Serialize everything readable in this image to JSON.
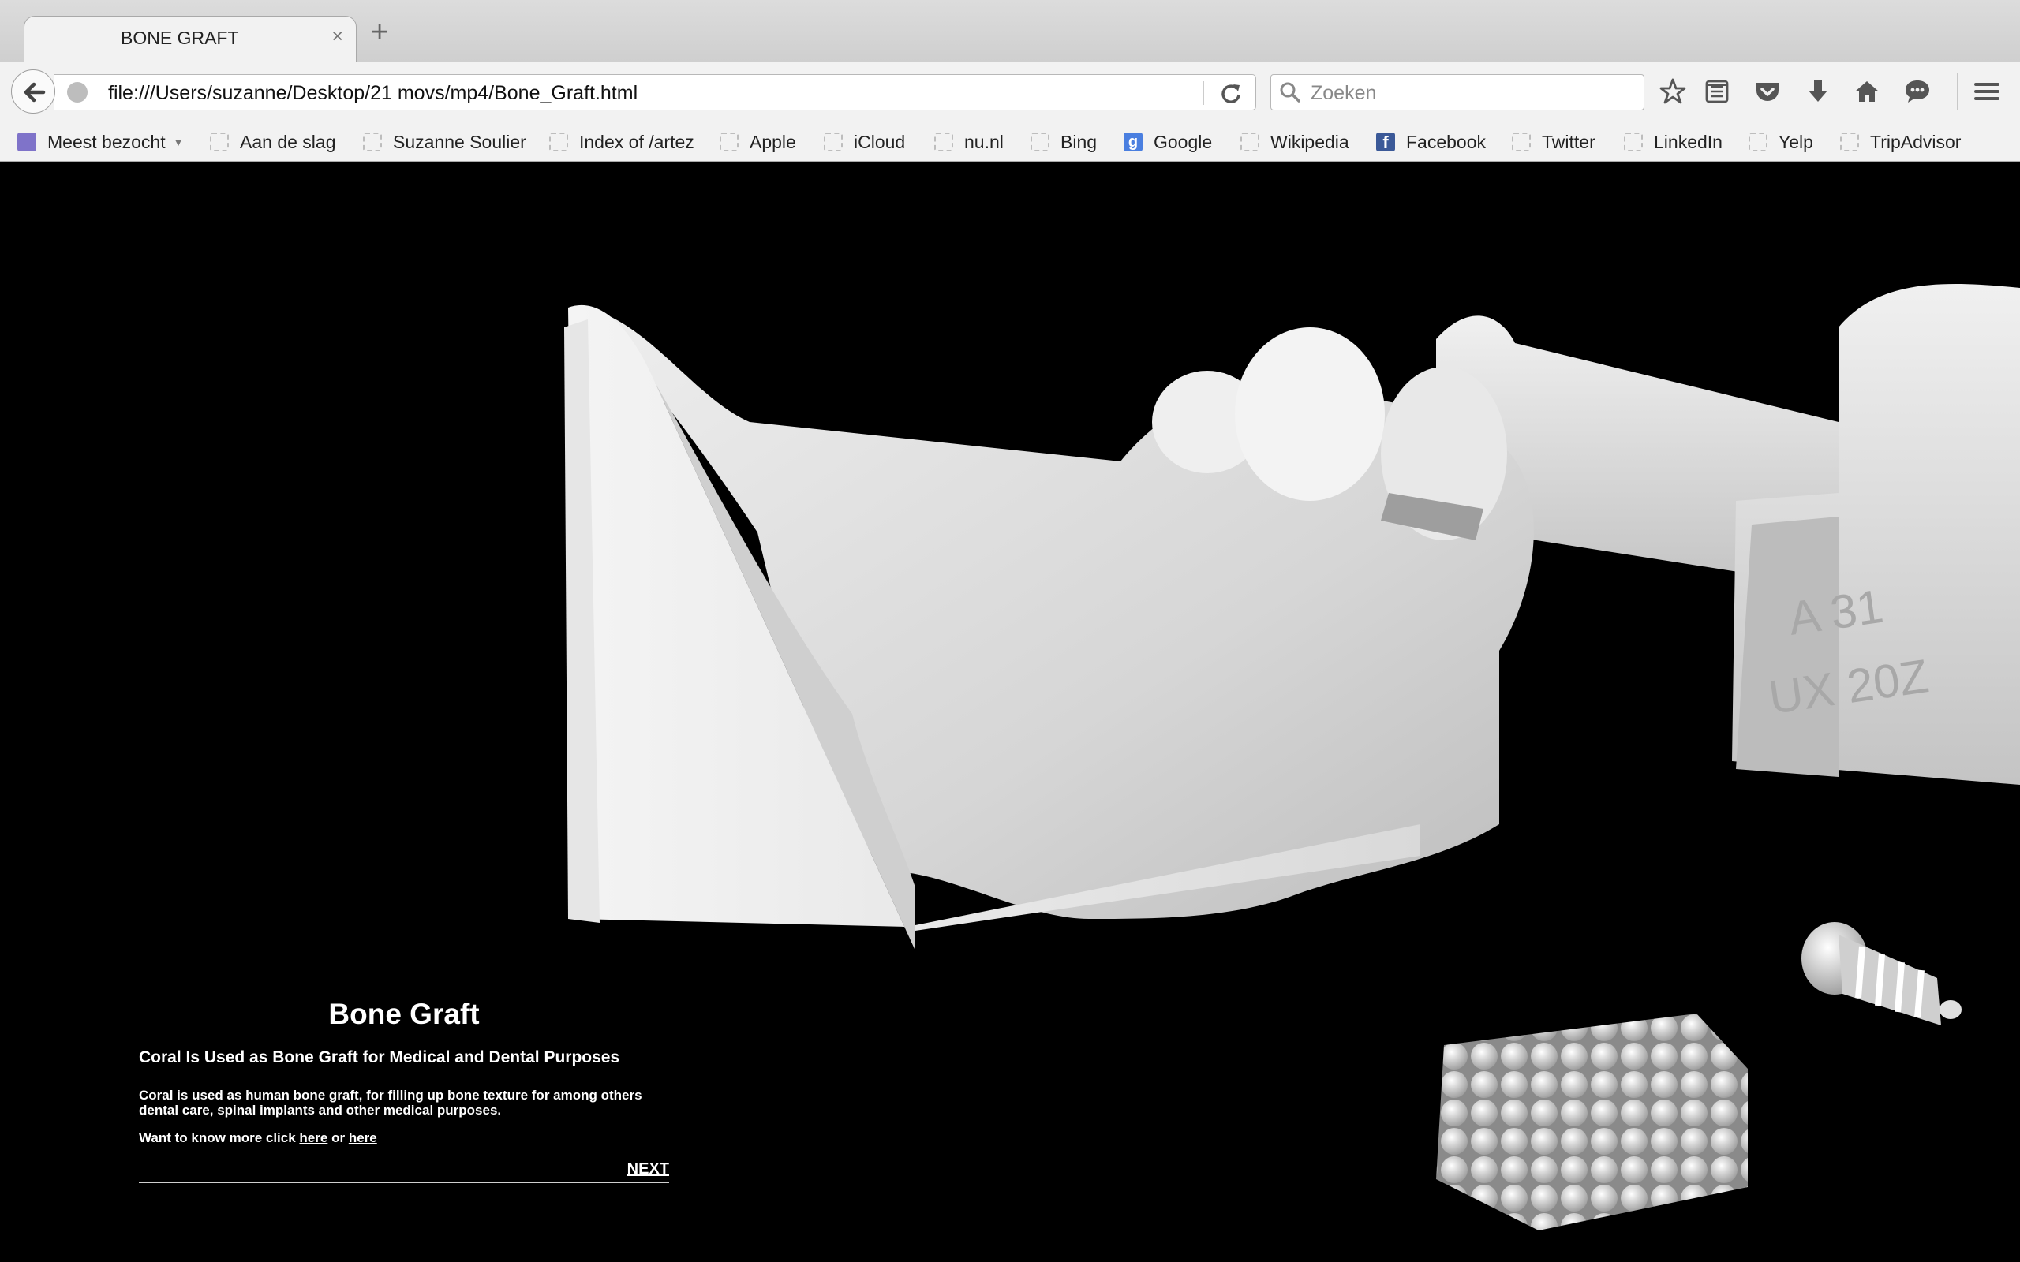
{
  "browser": {
    "tab_title": "BONE GRAFT",
    "close_glyph": "×",
    "newtab_glyph": "+",
    "url": "file:///Users/suzanne/Desktop/21 movs/mp4/Bone_Graft.html",
    "search_placeholder": "Zoeken"
  },
  "bookmarks": [
    {
      "label": "Meest bezocht",
      "icon": "folder"
    },
    {
      "label": "Aan de slag",
      "icon": "blank"
    },
    {
      "label": "Suzanne Soulier",
      "icon": "blank"
    },
    {
      "label": "Index of /artez",
      "icon": "blank"
    },
    {
      "label": "Apple",
      "icon": "blank"
    },
    {
      "label": "iCloud",
      "icon": "blank"
    },
    {
      "label": "nu.nl",
      "icon": "blank"
    },
    {
      "label": "Bing",
      "icon": "blank"
    },
    {
      "label": "Google",
      "icon": "google",
      "glyph": "g"
    },
    {
      "label": "Wikipedia",
      "icon": "blank"
    },
    {
      "label": "Facebook",
      "icon": "facebook",
      "glyph": "f"
    },
    {
      "label": "Twitter",
      "icon": "blank"
    },
    {
      "label": "LinkedIn",
      "icon": "blank"
    },
    {
      "label": "Yelp",
      "icon": "blank"
    },
    {
      "label": "TripAdvisor",
      "icon": "blank"
    }
  ],
  "scene": {
    "engraving_line1": "A 31",
    "engraving_line2": "UX 20Z"
  },
  "content": {
    "title": "Bone Graft",
    "subtitle": "Coral Is Used as Bone Graft for Medical and Dental Purposes",
    "body": "Coral is used as human bone graft, for filling up bone texture for among others dental care, spinal implants and other medical purposes.",
    "more_prefix": "Want to know more click",
    "link1": "here",
    "link_joiner": "or",
    "link2": "here",
    "next_label": "NEXT"
  }
}
